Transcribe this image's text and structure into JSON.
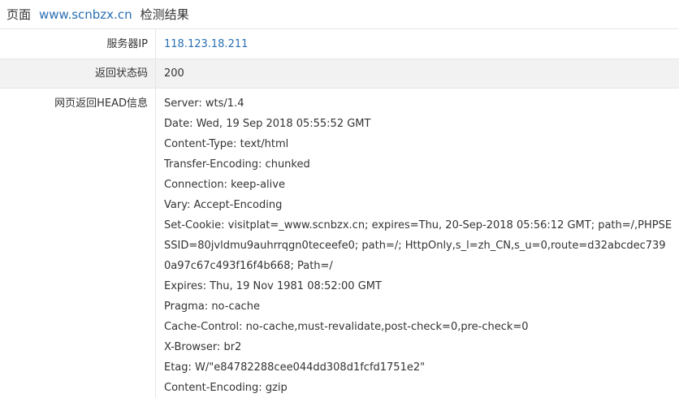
{
  "header": {
    "prefix": "页面",
    "domain": "www.scnbzx.cn",
    "suffix": "检测结果"
  },
  "rows": {
    "ip": {
      "label": "服务器IP",
      "value": "118.123.18.211"
    },
    "status": {
      "label": "返回状态码",
      "value": "200"
    },
    "head": {
      "label": "网页返回HEAD信息",
      "lines": [
        "Server: wts/1.4",
        "Date: Wed, 19 Sep 2018 05:55:52 GMT",
        "Content-Type: text/html",
        "Transfer-Encoding: chunked",
        "Connection: keep-alive",
        "Vary: Accept-Encoding",
        "Set-Cookie: visitplat=_www.scnbzx.cn; expires=Thu, 20-Sep-2018 05:56:12 GMT; path=/,PHPSE",
        "SSID=80jvldmu9auhrrqgn0teceefe0; path=/; HttpOnly,s_l=zh_CN,s_u=0,route=d32abcdec739",
        "0a97c67c493f16f4b668; Path=/",
        "Expires: Thu, 19 Nov 1981 08:52:00 GMT",
        "Pragma: no-cache",
        "Cache-Control: no-cache,must-revalidate,post-check=0,pre-check=0",
        "X-Browser: br2",
        "Etag: W/\"e84782288cee044dd308d1fcfd1751e2\"",
        "Content-Encoding: gzip"
      ]
    }
  }
}
